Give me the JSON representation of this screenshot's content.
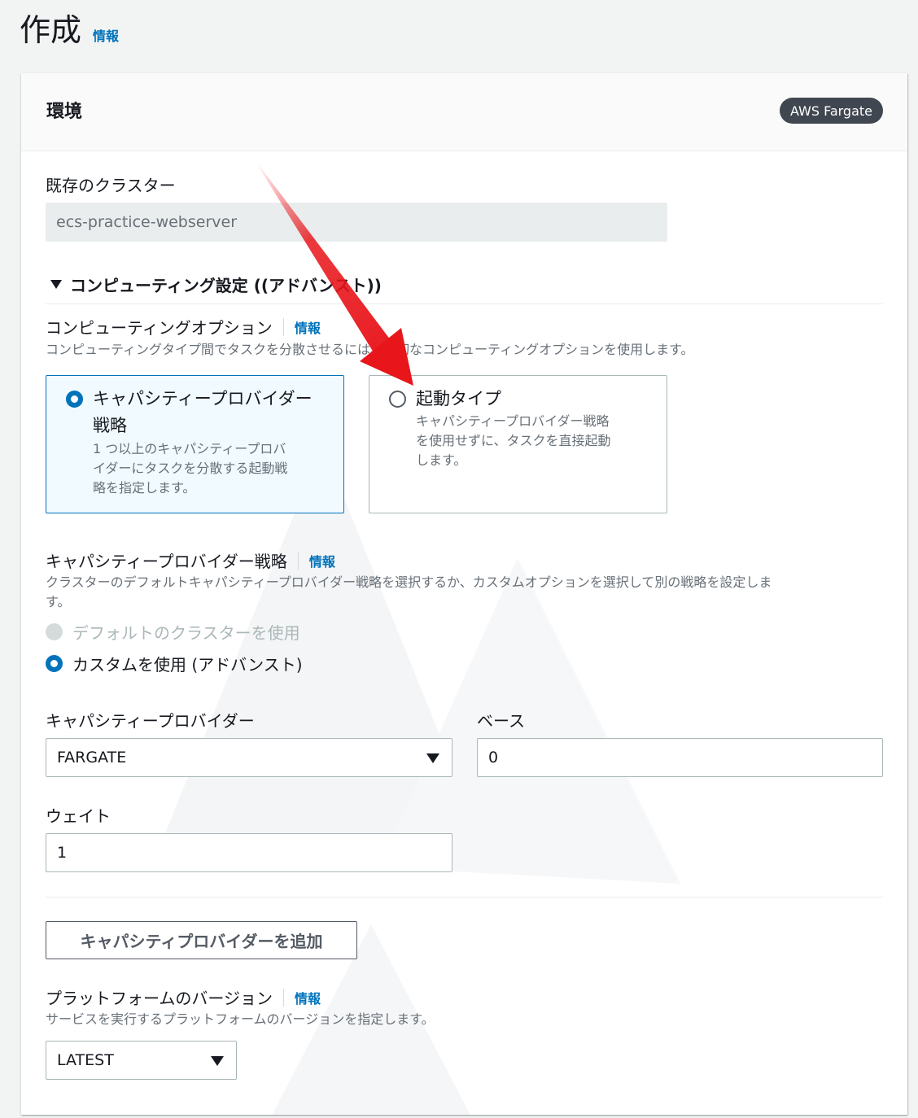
{
  "page": {
    "title": "作成",
    "info": "情報"
  },
  "environment": {
    "heading": "環境",
    "badge": "AWS Fargate",
    "cluster_label": "既存のクラスター",
    "cluster_value": "ecs-practice-webserver",
    "expander_label": "コンピューティング設定 ((アドバンスト))"
  },
  "compute_option": {
    "label": "コンピューティングオプション",
    "info": "情報",
    "description": "コンピューティングタイプ間でタスクを分散させるには、適切なコンピューティングオプションを使用します。",
    "options": [
      {
        "title_line1": "キャパシティープロバイダー",
        "title_line2": "戦略",
        "desc_line1": "1 つ以上のキャパシティープロバ",
        "desc_line2": "イダーにタスクを分散する起動戦",
        "desc_line3": "略を指定します。",
        "selected": true
      },
      {
        "title_line1": "起動タイプ",
        "desc_line1": "キャパシティープロバイダー戦略",
        "desc_line2": "を使用せずに、タスクを直接起動",
        "desc_line3": "します。",
        "selected": false
      }
    ]
  },
  "strategy": {
    "label": "キャパシティープロバイダー戦略",
    "info": "情報",
    "description_line1": "クラスターのデフォルトキャパシティープロバイダー戦略を選択するか、カスタムオプションを選択して別の戦略を設定しま",
    "description_line2": "す。",
    "option_default": "デフォルトのクラスターを使用",
    "option_custom": "カスタムを使用 (アドバンスト)"
  },
  "provider": {
    "provider_label": "キャパシティープロバイダー",
    "provider_value": "FARGATE",
    "base_label": "ベース",
    "base_value": "0",
    "weight_label": "ウェイト",
    "weight_value": "1",
    "add_button": "キャパシティプロバイダーを追加"
  },
  "platform": {
    "label": "プラットフォームのバージョン",
    "info": "情報",
    "description": "サービスを実行するプラットフォームのバージョンを指定します。",
    "value": "LATEST"
  },
  "colors": {
    "accent": "#0073bb",
    "annotation_arrow": "#e8151b"
  }
}
